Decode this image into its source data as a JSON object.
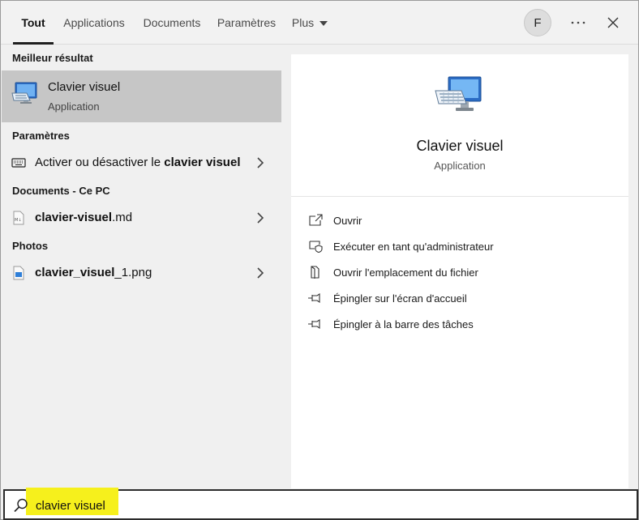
{
  "tabs": [
    {
      "label": "Tout",
      "active": true
    },
    {
      "label": "Applications"
    },
    {
      "label": "Documents"
    },
    {
      "label": "Paramètres"
    },
    {
      "label": "Plus"
    }
  ],
  "header": {
    "avatar_initial": "F",
    "more_icon": "ellipsis-icon",
    "close_icon": "close-icon"
  },
  "results": {
    "best_title": "Meilleur résultat",
    "best": {
      "name": "Clavier visuel",
      "type": "Application",
      "icon": "on-screen-keyboard-icon"
    },
    "settings_title": "Paramètres",
    "settings_item": {
      "prefix": "Activer ou désactiver le ",
      "bold": "clavier visuel",
      "icon": "keyboard-icon"
    },
    "documents_title": "Documents - Ce PC",
    "document_item": {
      "bold": "clavier-visuel",
      "suffix": ".md",
      "icon": "markdown-file-icon"
    },
    "photos_title": "Photos",
    "photo_item": {
      "bold": "clavier_visuel",
      "suffix": "_1.png",
      "icon": "image-file-icon"
    }
  },
  "preview": {
    "name": "Clavier visuel",
    "type": "Application",
    "actions": [
      {
        "label": "Ouvrir",
        "icon": "open-icon"
      },
      {
        "label": "Exécuter en tant qu'administrateur",
        "icon": "run-as-admin-icon"
      },
      {
        "label": "Ouvrir l'emplacement du fichier",
        "icon": "file-location-icon"
      },
      {
        "label": "Épingler sur l'écran d'accueil",
        "icon": "pin-icon"
      },
      {
        "label": "Épingler à la barre des tâches",
        "icon": "pin-icon"
      }
    ]
  },
  "search": {
    "value": "clavier visuel",
    "icon": "search-icon",
    "highlight_color": "#f6f01c"
  },
  "colors": {
    "selected_row": "#c6c6c6",
    "pane_background": "#f0f0f0",
    "preview_background": "#ffffff"
  }
}
